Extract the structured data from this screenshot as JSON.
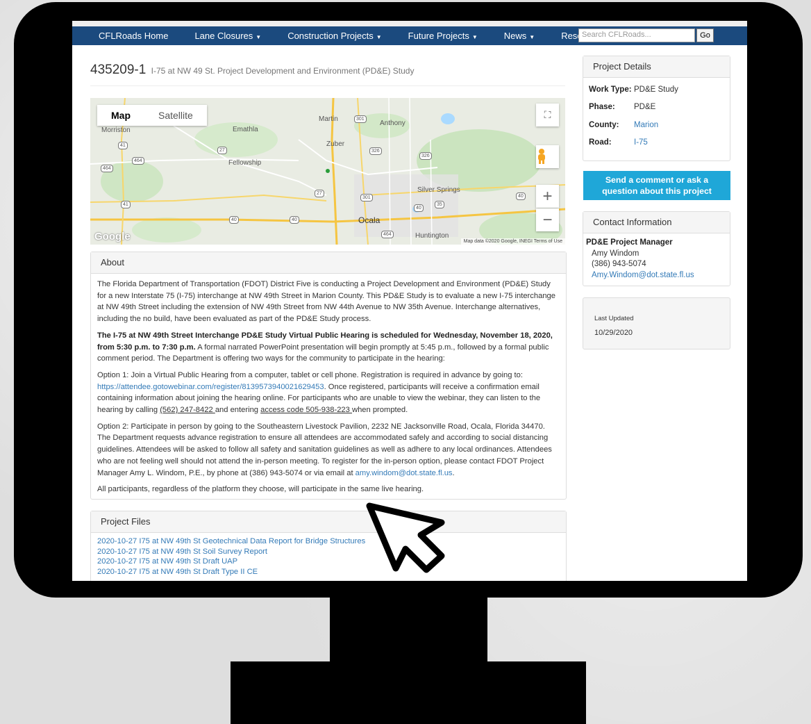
{
  "nav": {
    "items": [
      {
        "label": "CFLRoads Home",
        "dropdown": false
      },
      {
        "label": "Lane Closures",
        "dropdown": true
      },
      {
        "label": "Construction Projects",
        "dropdown": true
      },
      {
        "label": "Future Projects",
        "dropdown": true
      },
      {
        "label": "News",
        "dropdown": true
      },
      {
        "label": "Resources",
        "dropdown": true
      }
    ],
    "search_placeholder": "Search CFLRoads...",
    "go_label": "Go"
  },
  "project": {
    "number": "435209-1",
    "title": "I-75 at NW 49 St. Project Development and Environment (PD&E) Study"
  },
  "map": {
    "toggle_map": "Map",
    "toggle_satellite": "Satellite",
    "places": [
      "Morriston",
      "Emathla",
      "Martin",
      "Anthony",
      "Zuber",
      "Fellowship",
      "Silver Springs",
      "Ocala",
      "Huntington"
    ],
    "shields": [
      "301",
      "41",
      "27",
      "326",
      "326",
      "464",
      "464",
      "27",
      "301",
      "40",
      "35",
      "40",
      "41",
      "40",
      "40",
      "464"
    ],
    "credit": "Map data ©2020 Google, INEGI    Terms of Use",
    "logo": "Google"
  },
  "about": {
    "heading": "About",
    "p1": "The Florida Department of Transportation (FDOT) District Five is conducting a Project Development and Environment (PD&E) Study for a new Interstate 75 (I-75) interchange at NW 49th Street in Marion County. This PD&E Study is to evaluate a new I-75 interchange at NW 49th Street including the extension of NW 49th Street from NW 44th Avenue to NW 35th Avenue. Interchange alternatives, including the no build, have been evaluated as part of the PD&E Study process.",
    "p2_bold": "The I-75 at NW 49th Street Interchange PD&E Study Virtual Public Hearing is scheduled for Wednesday, November 18, 2020, from 5:30 p.m. to 7:30 p.m.",
    "p2_rest": " A formal narrated PowerPoint presentation will begin promptly at 5:45 p.m., followed by a formal public comment period. The Department is offering two ways for the community to participate in the hearing:",
    "p3_a": "Option 1: Join a Virtual Public Hearing from a computer, tablet or cell phone. Registration is required in advance by going to: ",
    "p3_link": "https://attendee.gotowebinar.com/register/8139573940021629453",
    "p3_b": ". Once registered, participants will receive a confirmation email containing information about joining the hearing online. For participants who are unable to view the webinar, they can listen to the hearing by calling ",
    "p3_phone": "(562) 247-8422 ",
    "p3_c": "and entering ",
    "p3_code": "access code 505-938-223 ",
    "p3_d": "when prompted.",
    "p4_a": "Option 2: Participate in person by going to the Southeastern Livestock Pavilion, 2232 NE Jacksonville Road, Ocala, Florida 34470. The Department requests advance registration to ensure all attendees are accommodated safely and according to social distancing guidelines. Attendees will be asked to follow all safety and sanitation guidelines as well as adhere to any local ordinances. Attendees who are not feeling well should not attend the in-person meeting. To register for the in-person option, please contact FDOT Project Manager Amy L. Windom, P.E., by phone at (386) 943-5074 or via email at ",
    "p4_link": "amy.windom@dot.state.fl.us",
    "p4_b": ".",
    "p5": "All participants, regardless of the platform they choose, will participate in the same live hearing."
  },
  "files": {
    "heading": "Project Files",
    "items": [
      "2020-10-27 I75 at NW 49th St Geotechnical Data Report for Bridge Structures",
      "2020-10-27 I75 at NW 49th St Soil Survey Report",
      "2020-10-27 I75 at NW 49th St Draft UAP",
      "2020-10-27 I75 at NW 49th St Draft Type II CE"
    ]
  },
  "details": {
    "heading": "Project Details",
    "rows": [
      {
        "key": "Work Type:",
        "value": "PD&E Study",
        "link": false
      },
      {
        "key": "Phase:",
        "value": "PD&E",
        "link": false
      },
      {
        "key": "County:",
        "value": "Marion",
        "link": true
      },
      {
        "key": "Road:",
        "value": "I-75",
        "link": true
      }
    ]
  },
  "comment_button": {
    "line1": "Send a comment or ask a",
    "line2": "question about this project"
  },
  "contact": {
    "heading": "Contact Information",
    "role": "PD&E Project Manager",
    "name": "Amy Windom",
    "phone": "(386) 943-5074",
    "email": "Amy.Windom@dot.state.fl.us"
  },
  "updated": {
    "label": "Last Updated",
    "date": "10/29/2020"
  },
  "colors": {
    "navbar": "#1b4a7e",
    "link": "#337ab7",
    "button": "#1fa7d8"
  },
  "icons": [
    "caret-down-icon",
    "fullscreen-icon",
    "pegman-icon",
    "zoom-in-icon",
    "zoom-out-icon",
    "cursor-arrow-icon"
  ]
}
